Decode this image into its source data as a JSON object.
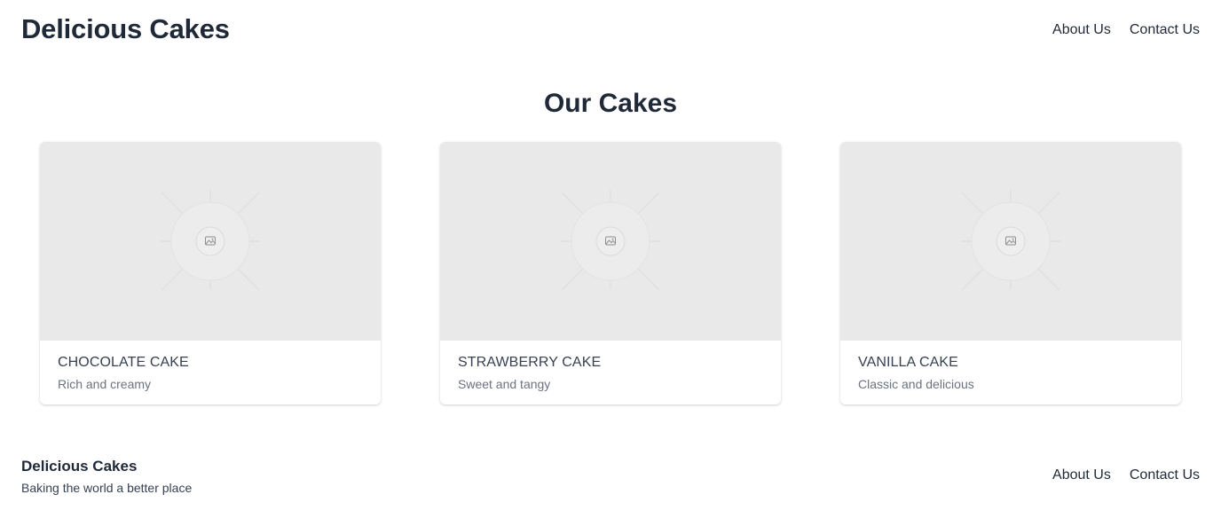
{
  "header": {
    "brand": "Delicious Cakes",
    "nav": [
      "About Us",
      "Contact Us"
    ]
  },
  "main": {
    "title": "Our Cakes",
    "cards": [
      {
        "title": "CHOCOLATE CAKE",
        "description": "Rich and creamy",
        "image_icon": "image-placeholder-icon"
      },
      {
        "title": "STRAWBERRY CAKE",
        "description": "Sweet and tangy",
        "image_icon": "image-placeholder-icon"
      },
      {
        "title": "VANILLA CAKE",
        "description": "Classic and delicious",
        "image_icon": "image-placeholder-icon"
      }
    ]
  },
  "footer": {
    "brand": "Delicious Cakes",
    "tagline": "Baking the world a better place",
    "nav": [
      "About Us",
      "Contact Us"
    ]
  },
  "colors": {
    "text_primary": "#1f2937",
    "text_secondary": "#6b7280",
    "placeholder_bg": "#e9e9e9"
  }
}
